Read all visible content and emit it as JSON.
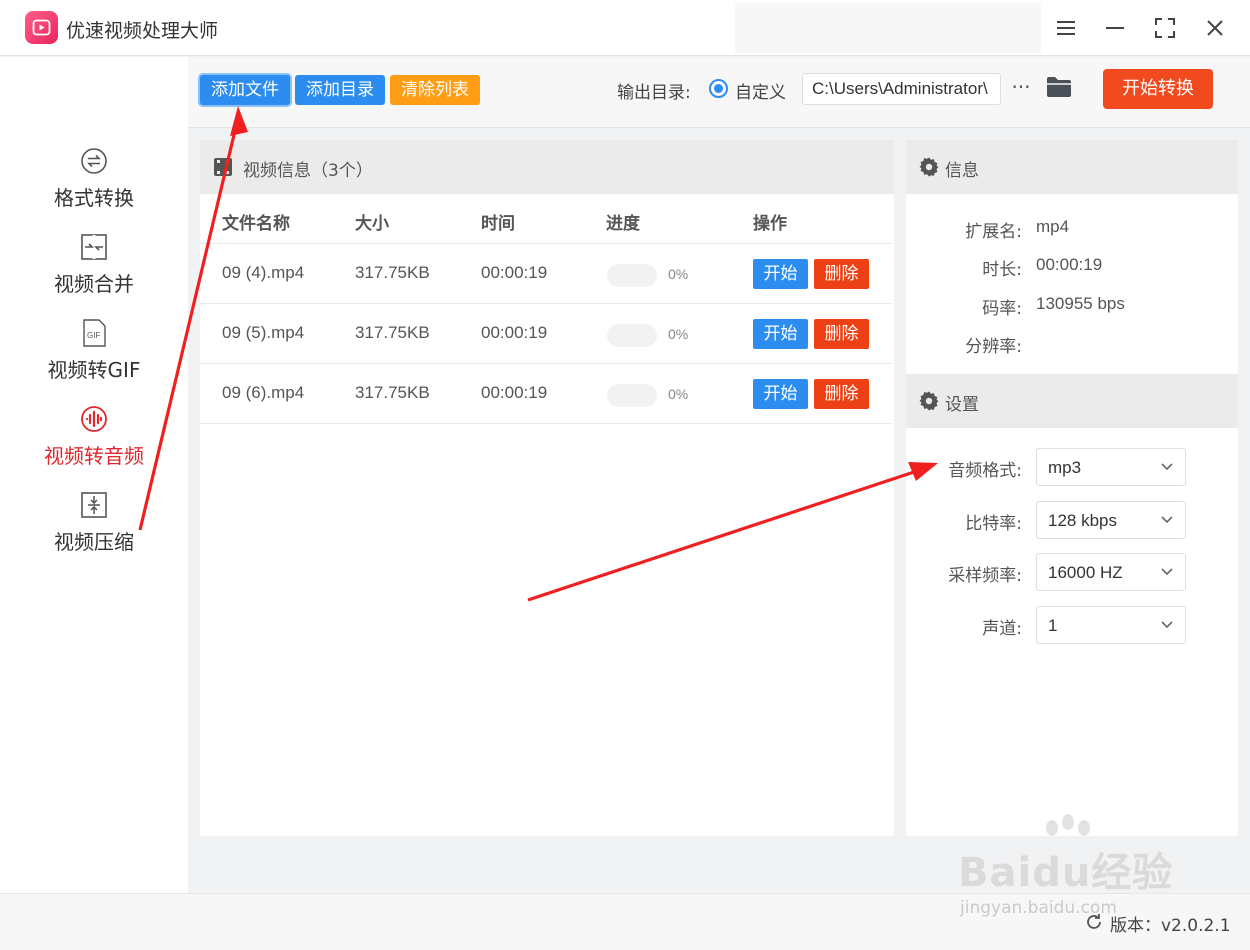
{
  "app": {
    "title": "优速视频处理大师"
  },
  "sidebar": {
    "items": [
      {
        "label": "格式转换",
        "icon": "format-convert-icon",
        "active": false
      },
      {
        "label": "视频合并",
        "icon": "merge-icon",
        "active": false
      },
      {
        "label": "视频转GIF",
        "icon": "gif-icon",
        "active": false
      },
      {
        "label": "视频转音频",
        "icon": "audio-wave-icon",
        "active": true
      },
      {
        "label": "视频压缩",
        "icon": "compress-icon",
        "active": false
      }
    ]
  },
  "toolbar": {
    "add_file": "添加文件",
    "add_dir": "添加目录",
    "clear_list": "清除列表",
    "output_label": "输出目录:",
    "radio_label": "自定义",
    "output_path": "C:\\Users\\Administrator\\",
    "more": "···",
    "start_convert": "开始转换"
  },
  "files": {
    "header_title": "视频信息（3个）",
    "columns": [
      "文件名称",
      "大小",
      "时间",
      "进度",
      "操作"
    ],
    "rows": [
      {
        "name": "09 (4).mp4",
        "size": "317.75KB",
        "time": "00:00:19",
        "progress": 0,
        "progress_text": "0%"
      },
      {
        "name": "09 (5).mp4",
        "size": "317.75KB",
        "time": "00:00:19",
        "progress": 0,
        "progress_text": "0%"
      },
      {
        "name": "09 (6).mp4",
        "size": "317.75KB",
        "time": "00:00:19",
        "progress": 0,
        "progress_text": "0%"
      }
    ],
    "start_label": "开始",
    "delete_label": "删除"
  },
  "info": {
    "title": "信息",
    "ext_label": "扩展名:",
    "ext": "mp4",
    "duration_label": "时长:",
    "duration": "00:00:19",
    "bitrate_label": "码率:",
    "bitrate": "130955 bps",
    "resolution_label": "分辨率:",
    "resolution": ""
  },
  "settings": {
    "title": "设置",
    "audio_format_label": "音频格式:",
    "audio_format": "mp3",
    "bitrate_label": "比特率:",
    "bitrate": "128 kbps",
    "sample_rate_label": "采样频率:",
    "sample_rate": "16000 HZ",
    "channel_label": "声道:",
    "channel": "1"
  },
  "footer": {
    "version": "版本：v2.0.2.1"
  },
  "watermark": {
    "text": "Baidu经验",
    "sub": "jingyan.baidu.com"
  },
  "colors": {
    "accent_blue": "#2d8cf0",
    "orange": "#ff9d14",
    "red": "#ed4014",
    "start_red": "#f04a1e",
    "active_sidebar": "#e0282e",
    "arrow": "#f02020"
  }
}
